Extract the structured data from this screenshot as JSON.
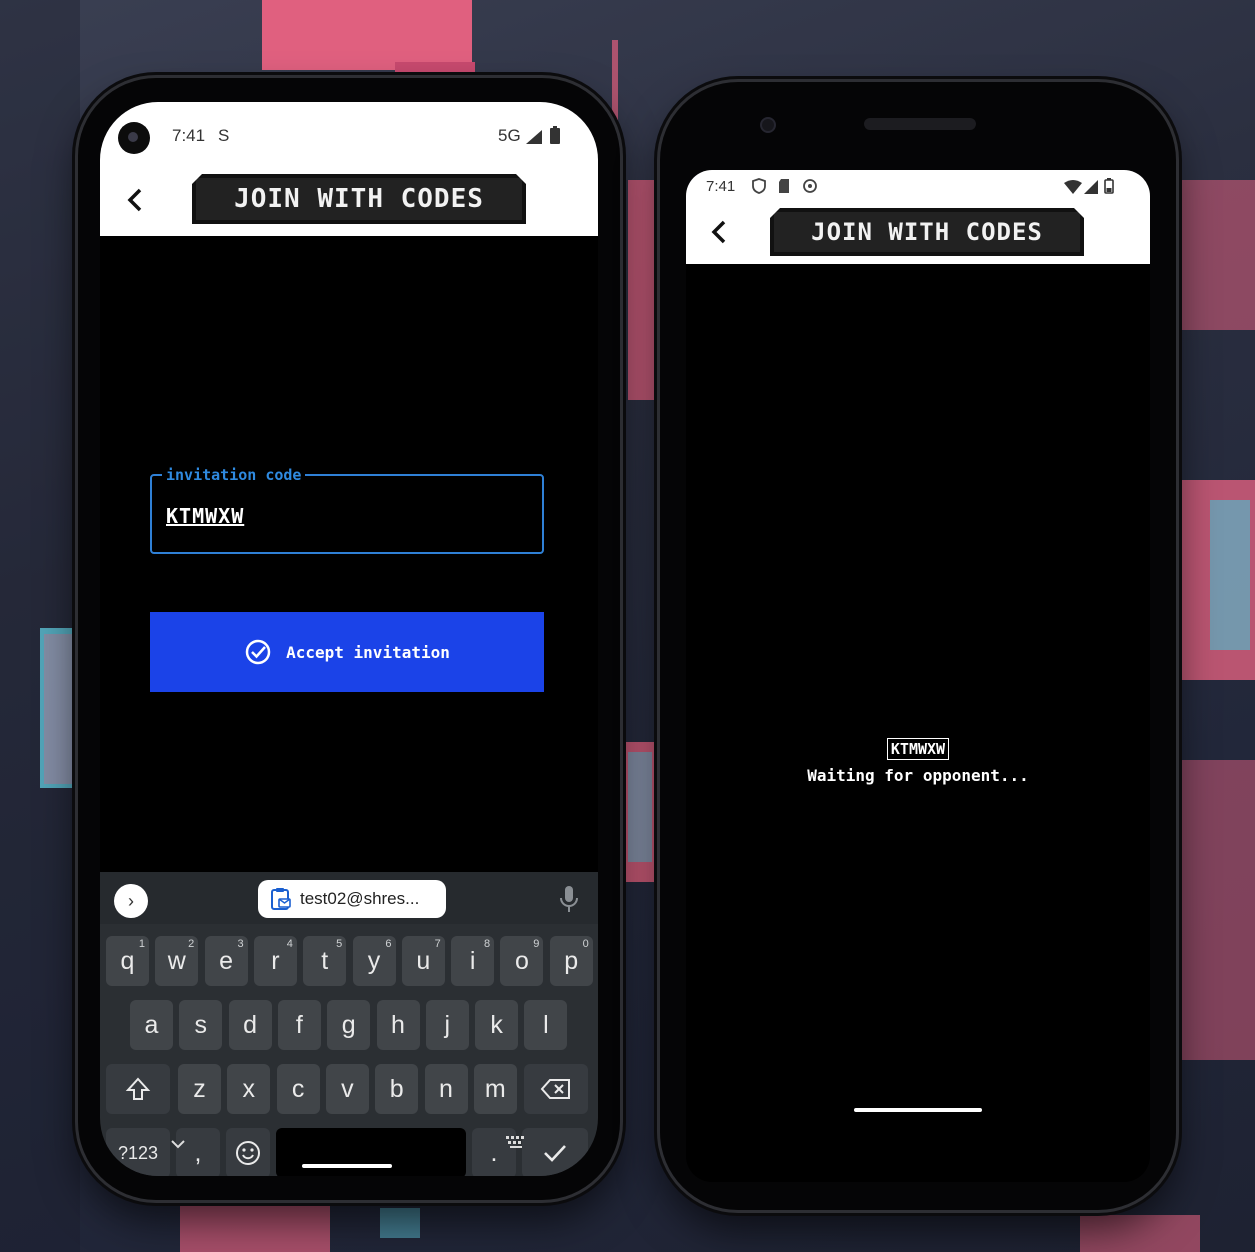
{
  "left_phone": {
    "status": {
      "time": "7:41",
      "carrier_icon": "S",
      "network": "5G"
    },
    "header": {
      "title": "JOIN WITH CODES"
    },
    "invitation": {
      "label": "invitation code",
      "value": "KTMWXW"
    },
    "accept_button": {
      "label": "Accept invitation"
    },
    "keyboard": {
      "suggestion_chip": "test02@shres...",
      "row1": [
        {
          "k": "q",
          "s": "1"
        },
        {
          "k": "w",
          "s": "2"
        },
        {
          "k": "e",
          "s": "3"
        },
        {
          "k": "r",
          "s": "4"
        },
        {
          "k": "t",
          "s": "5"
        },
        {
          "k": "y",
          "s": "6"
        },
        {
          "k": "u",
          "s": "7"
        },
        {
          "k": "i",
          "s": "8"
        },
        {
          "k": "o",
          "s": "9"
        },
        {
          "k": "p",
          "s": "0"
        }
      ],
      "row2": [
        "a",
        "s",
        "d",
        "f",
        "g",
        "h",
        "j",
        "k",
        "l"
      ],
      "row3": [
        "z",
        "x",
        "c",
        "v",
        "b",
        "n",
        "m"
      ],
      "symbols_key": "?123",
      "comma_key": ",",
      "period_key": "."
    }
  },
  "right_phone": {
    "status": {
      "time": "7:41"
    },
    "header": {
      "title": "JOIN WITH CODES"
    },
    "waiting": {
      "code": "KTMWXW",
      "text": "Waiting for opponent..."
    }
  },
  "colors": {
    "accent_blue": "#1b43e8",
    "field_border": "#2f80d6",
    "badge_bg": "#222222"
  }
}
